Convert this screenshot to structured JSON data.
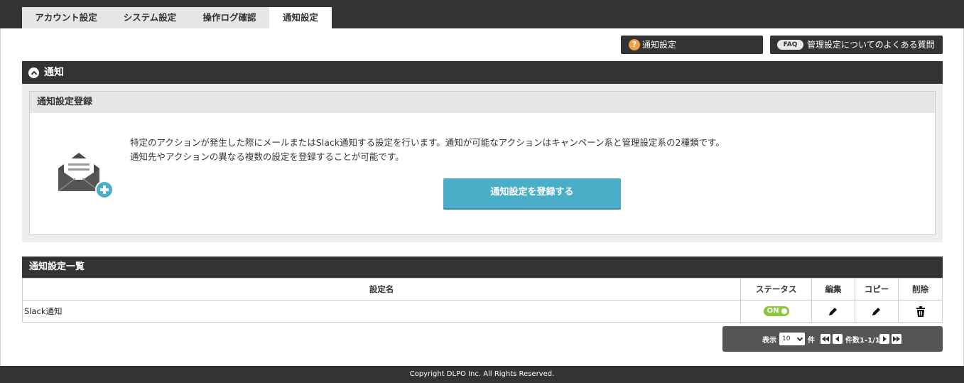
{
  "tabs": [
    {
      "label": "アカウント設定"
    },
    {
      "label": "システム設定"
    },
    {
      "label": "操作ログ確認"
    },
    {
      "label": "通知設定"
    }
  ],
  "help": {
    "notification_label": "通知設定",
    "faq_badge": "FAQ",
    "faq_label": "管理設定についてのよくある質問"
  },
  "section": {
    "title": "通知",
    "register": {
      "heading": "通知設定登録",
      "line1": "特定のアクションが発生した際にメールまたはSlack通知する設定を行います。通知が可能なアクションはキャンペーン系と管理設定系の2種類です。",
      "line2": "通知先やアクションの異なる複数の設定を登録することが可能です。",
      "button": "通知設定を登録する"
    }
  },
  "list": {
    "title": "通知設定一覧",
    "columns": [
      "設定名",
      "ステータス",
      "編集",
      "コピー",
      "削除"
    ],
    "rows": [
      {
        "name": "Slack通知",
        "status": "ON"
      }
    ]
  },
  "pagination": {
    "show_label": "表示",
    "per_page": "10",
    "unit": "件",
    "range": "件数1-1/1"
  },
  "footer": {
    "copyright": "Copyright DLPO Inc. All Rights Reserved."
  },
  "colors": {
    "accent": "#4aaec8",
    "dark": "#333333",
    "toggle_on": "#8cc63f",
    "help_orange": "#f0a041"
  }
}
